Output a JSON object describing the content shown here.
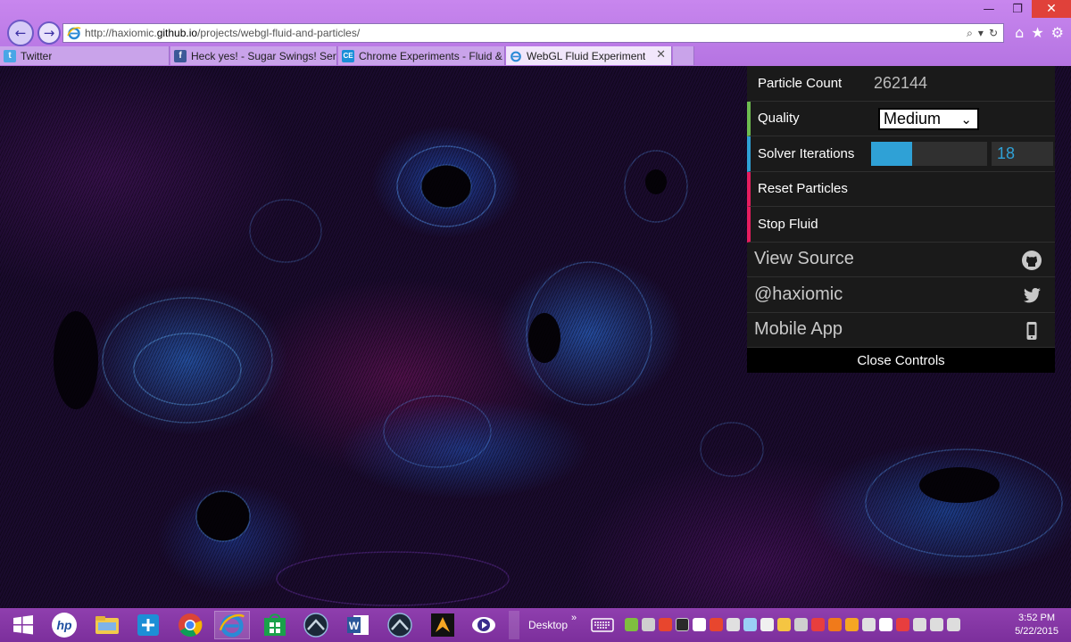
{
  "window": {
    "minimize_glyph": "—",
    "restore_glyph": "❐",
    "close_glyph": "✕"
  },
  "browser": {
    "back_glyph": "←",
    "forward_glyph": "→",
    "url_prefix": "http://haxiomic.",
    "url_host": "github.io",
    "url_suffix": "/projects/webgl-fluid-and-particles/",
    "search_glyph": "⌕",
    "dropdown_glyph": "▾",
    "refresh_glyph": "↻",
    "home_glyph": "⌂",
    "favorites_glyph": "★",
    "tools_glyph": "⚙",
    "tabs": [
      {
        "label": "Twitter",
        "favicon": "twitter-icon",
        "color": "#4aa6e6"
      },
      {
        "label": "Heck yes! - Sugar Swings! Serv...",
        "favicon": "facebook-icon",
        "color": "#3b5998"
      },
      {
        "label": "Chrome Experiments - Fluid & ...",
        "favicon": "chrome-experiments-icon",
        "color": "#1a8fd8"
      },
      {
        "label": "WebGL Fluid Experiment",
        "favicon": "ie-icon",
        "color": "#2a8ad6",
        "active": true
      }
    ],
    "tab_close_glyph": "✕"
  },
  "controls": {
    "particle_count_label": "Particle Count",
    "particle_count_value": "262144",
    "quality_label": "Quality",
    "quality_value": "Medium",
    "solver_label": "Solver Iterations",
    "solver_value": "18",
    "solver_fraction": 0.35,
    "reset_label": "Reset Particles",
    "stop_label": "Stop Fluid",
    "view_source_label": "View Source",
    "twitter_label": "@haxiomic",
    "mobile_label": "Mobile App",
    "close_label": "Close Controls",
    "accent_number": "#1a1a1a",
    "accent_select": "#6dbb50",
    "accent_slider": "#2fa1d6",
    "accent_function": "#e61d5f"
  },
  "taskbar": {
    "desktop_label": "Desktop",
    "chevron": "»",
    "time": "3:52 PM",
    "date": "5/22/2015",
    "apps": [
      "start-icon",
      "hp-icon",
      "file-explorer-icon",
      "network-app-icon",
      "chrome-icon",
      "ie-icon",
      "store-icon",
      "steam-like-icon",
      "word-icon",
      "steam-like-icon-2",
      "games-icon",
      "media-icon"
    ]
  }
}
